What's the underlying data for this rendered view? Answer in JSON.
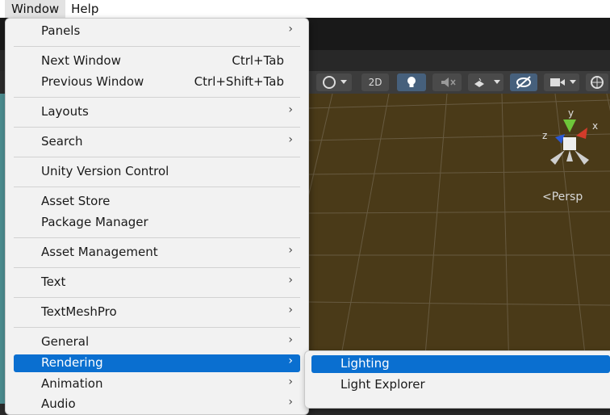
{
  "menubar": {
    "items": [
      {
        "label": "Window",
        "active": true
      },
      {
        "label": "Help",
        "active": false
      }
    ]
  },
  "window_menu": {
    "items": [
      {
        "label": "Panels",
        "has_submenu": true
      },
      {
        "label": "Next Window",
        "shortcut": "Ctrl+Tab"
      },
      {
        "label": "Previous Window",
        "shortcut": "Ctrl+Shift+Tab"
      },
      {
        "label": "Layouts",
        "has_submenu": true
      },
      {
        "label": "Search",
        "has_submenu": true
      },
      {
        "label": "Unity Version Control"
      },
      {
        "label": "Asset Store"
      },
      {
        "label": "Package Manager"
      },
      {
        "label": "Asset Management",
        "has_submenu": true
      },
      {
        "label": "Text",
        "has_submenu": true
      },
      {
        "label": "TextMeshPro",
        "has_submenu": true
      },
      {
        "label": "General",
        "has_submenu": true
      },
      {
        "label": "Rendering",
        "has_submenu": true,
        "selected": true
      },
      {
        "label": "Animation",
        "has_submenu": true
      },
      {
        "label": "Audio",
        "has_submenu": true
      }
    ],
    "arrow_glyph": "›"
  },
  "rendering_submenu": {
    "items": [
      {
        "label": "Lighting",
        "selected": true
      },
      {
        "label": "Light Explorer"
      }
    ]
  },
  "scene_view": {
    "toolbar": {
      "mode_2d_label": "2D",
      "icons": [
        "render-mode-icon",
        "lighting-toggle-icon",
        "audio-mute-icon",
        "effects-icon",
        "visibility-icon",
        "camera-icon",
        "gizmo-icon"
      ]
    },
    "gizmo": {
      "axes": [
        "y",
        "x",
        "z"
      ]
    },
    "projection_label": "<Persp"
  },
  "colors": {
    "selection": "#0a6fd0",
    "menu_bg": "#f2f2f2",
    "scene_bg": "#4a3a18",
    "accent_toolbar": "#46607c"
  }
}
